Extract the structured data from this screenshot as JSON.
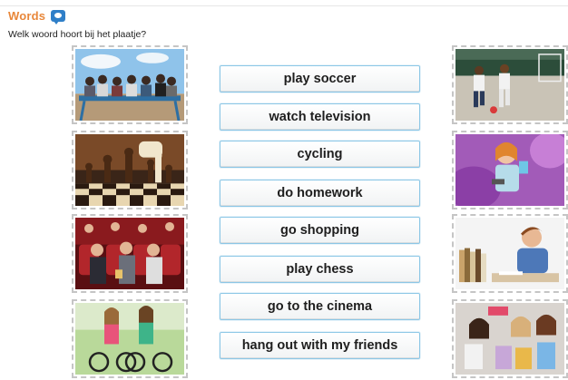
{
  "header": {
    "title": "Words",
    "icon": "chat-bubble-icon",
    "accent": "#e8873a"
  },
  "instruction": "Welk woord hoort bij het plaatje?",
  "words": [
    "play soccer",
    "watch television",
    "cycling",
    "do homework",
    "go shopping",
    "play chess",
    "go to the cinema",
    "hang out with my friends"
  ],
  "left_images": [
    "friends-on-bench-image",
    "chess-board-image",
    "cinema-audience-image",
    "girls-cycling-image"
  ],
  "right_images": [
    "boys-soccer-image",
    "girl-watching-tv-image",
    "boy-doing-homework-image",
    "girls-shopping-image"
  ]
}
